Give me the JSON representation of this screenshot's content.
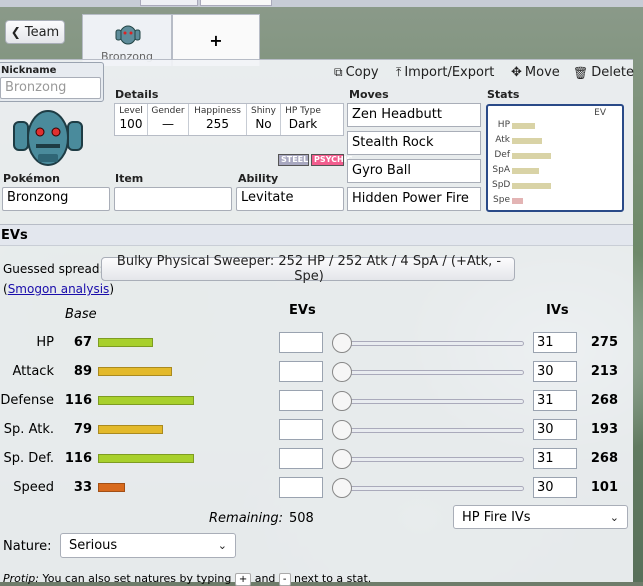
{
  "colors": {
    "bar_green": "#a8d02c",
    "bar_yellow": "#e3b92a",
    "bar_orange": "#d86a1d",
    "stat_mini_bar": "#d9d3a6",
    "stat_mini_bar_low": "#e3b4b4",
    "steel": "#a8a8c0",
    "psychic": "#f25d8e"
  },
  "tabs": {
    "team_button": "Team",
    "current_mon": "Bronzong",
    "add_tab": "+"
  },
  "header": {
    "nickname_label": "Nickname",
    "nickname_placeholder": "Bronzong",
    "details_label": "Details",
    "moves_label": "Moves",
    "stats_label": "Stats",
    "actions": {
      "copy": "Copy",
      "import_export": "Import/Export",
      "move": "Move",
      "delete": "Delete"
    }
  },
  "details": {
    "level_label": "Level",
    "level": "100",
    "gender_label": "Gender",
    "gender": "—",
    "happiness_label": "Happiness",
    "happiness": "255",
    "shiny_label": "Shiny",
    "shiny": "No",
    "hptype_label": "HP Type",
    "hptype": "Dark"
  },
  "types": [
    "STEEL",
    "PSYCHIC"
  ],
  "fields": {
    "pokemon_label": "Pokémon",
    "pokemon": "Bronzong",
    "item_label": "Item",
    "item": "",
    "ability_label": "Ability",
    "ability": "Levitate"
  },
  "moves": [
    "Zen Headbutt",
    "Stealth Rock",
    "Gyro Ball",
    "Hidden Power Fire"
  ],
  "stats_mini": {
    "ev_label": "EV",
    "rows": [
      {
        "name": "HP",
        "base": 67
      },
      {
        "name": "Atk",
        "base": 89
      },
      {
        "name": "Def",
        "base": 116
      },
      {
        "name": "SpA",
        "base": 79
      },
      {
        "name": "SpD",
        "base": 116
      },
      {
        "name": "Spe",
        "base": 33
      }
    ]
  },
  "evs_section": {
    "title": "EVs",
    "guessed_label": "Guessed spread:",
    "guessed_value": "Bulky Physical Sweeper: 252 HP / 252 Atk / 4 SpA / (+Atk, -Spe)",
    "smogon_prefix": "(",
    "smogon_link": "Smogon analysis",
    "smogon_suffix": ")",
    "base_header": "Base",
    "evs_header": "EVs",
    "ivs_header": "IVs",
    "rows": [
      {
        "name": "HP",
        "base": "67",
        "base_num": 67,
        "iv": "31",
        "total": "275",
        "color": "#a8d02c"
      },
      {
        "name": "Attack",
        "base": "89",
        "base_num": 89,
        "iv": "30",
        "total": "213",
        "color": "#e3b92a"
      },
      {
        "name": "Defense",
        "base": "116",
        "base_num": 116,
        "iv": "31",
        "total": "268",
        "color": "#a8d02c"
      },
      {
        "name": "Sp. Atk.",
        "base": "79",
        "base_num": 79,
        "iv": "30",
        "total": "193",
        "color": "#e3b92a"
      },
      {
        "name": "Sp. Def.",
        "base": "116",
        "base_num": 116,
        "iv": "31",
        "total": "268",
        "color": "#a8d02c"
      },
      {
        "name": "Speed",
        "base": "33",
        "base_num": 33,
        "iv": "30",
        "total": "101",
        "color": "#d86a1d"
      }
    ],
    "remaining_label": "Remaining:",
    "remaining_value": "508",
    "ivs_select": "HP Fire IVs",
    "nature_label": "Nature:",
    "nature_value": "Serious",
    "protip_prefix": "Protip:",
    "protip_text_1": "You can also set natures by typing",
    "protip_key_plus": "+",
    "protip_and": "and",
    "protip_key_minus": "-",
    "protip_text_2": "next to a stat."
  }
}
